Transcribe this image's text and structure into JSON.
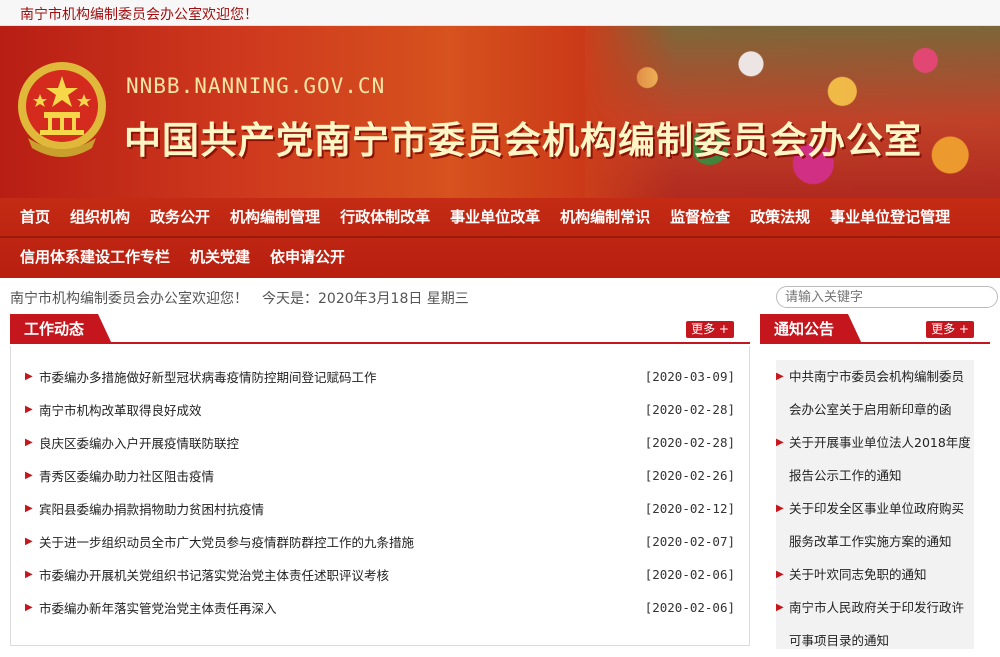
{
  "topbar": {
    "welcome": "南宁市机构编制委员会办公室欢迎您！"
  },
  "banner": {
    "url": "NNBB.NANNING.GOV.CN",
    "title": "中国共产党南宁市委员会机构编制委员会办公室"
  },
  "nav": {
    "row1": [
      "首页",
      "组织机构",
      "政务公开",
      "机构编制管理",
      "行政体制改革",
      "事业单位改革",
      "机构编制常识",
      "监督检查",
      "政策法规",
      "事业单位登记管理"
    ],
    "row2": [
      "信用体系建设工作专栏",
      "机关党建",
      "依申请公开"
    ]
  },
  "welcome_line": {
    "greeting": "南宁市机构编制委员会办公室欢迎您！",
    "date": "今天是：2020年3月18日 星期三"
  },
  "search": {
    "placeholder": "请输入关键字"
  },
  "work_news": {
    "title": "工作动态",
    "more": "更多 +",
    "items": [
      {
        "title": "市委编办多措施做好新型冠状病毒疫情防控期间登记赋码工作",
        "date": "[2020-03-09]"
      },
      {
        "title": "南宁市机构改革取得良好成效",
        "date": "[2020-02-28]"
      },
      {
        "title": "良庆区委编办入户开展疫情联防联控",
        "date": "[2020-02-28]"
      },
      {
        "title": "青秀区委编办助力社区阻击疫情",
        "date": "[2020-02-26]"
      },
      {
        "title": "宾阳县委编办捐款捐物助力贫困村抗疫情",
        "date": "[2020-02-12]"
      },
      {
        "title": "关于进一步组织动员全市广大党员参与疫情群防群控工作的九条措施",
        "date": "[2020-02-07]"
      },
      {
        "title": "市委编办开展机关党组织书记落实党治党主体责任述职评议考核",
        "date": "[2020-02-06]"
      },
      {
        "title": "市委编办新年落实管党治党主体责任再深入",
        "date": "[2020-02-06]"
      }
    ]
  },
  "notices": {
    "title": "通知公告",
    "more": "更多 +",
    "items": [
      {
        "title": "中共南宁市委员会机构编制委员会办公室关于启用新印章的函"
      },
      {
        "title": "关于开展事业单位法人2018年度报告公示工作的通知"
      },
      {
        "title": "关于印发全区事业单位政府购买服务改革工作实施方案的通知"
      },
      {
        "title": "关于叶欢同志免职的通知"
      },
      {
        "title": "南宁市人民政府关于印发行政许可事项目录的通知"
      }
    ]
  },
  "icons": {
    "emblem": "national-emblem-icon",
    "list_bullet": "triangle-right-icon"
  },
  "colors": {
    "brand_red": "#c4161c",
    "nav_red": "#b81f10"
  }
}
